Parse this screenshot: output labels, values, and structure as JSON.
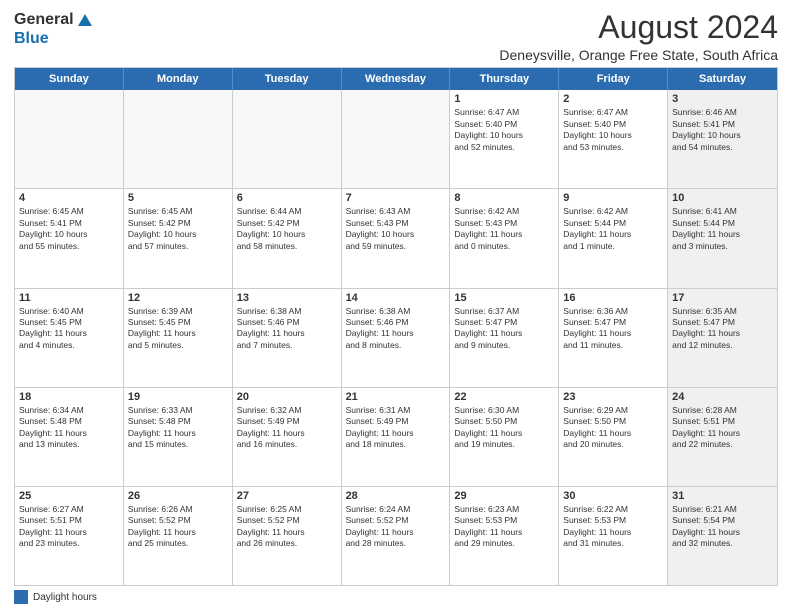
{
  "logo": {
    "general": "General",
    "blue": "Blue"
  },
  "header": {
    "title": "August 2024",
    "subtitle": "Deneysville, Orange Free State, South Africa"
  },
  "days_of_week": [
    "Sunday",
    "Monday",
    "Tuesday",
    "Wednesday",
    "Thursday",
    "Friday",
    "Saturday"
  ],
  "footer": {
    "label": "Daylight hours"
  },
  "weeks": [
    {
      "cells": [
        {
          "day": "",
          "info": "",
          "empty": true
        },
        {
          "day": "",
          "info": "",
          "empty": true
        },
        {
          "day": "",
          "info": "",
          "empty": true
        },
        {
          "day": "",
          "info": "",
          "empty": true
        },
        {
          "day": "1",
          "info": "Sunrise: 6:47 AM\nSunset: 5:40 PM\nDaylight: 10 hours\nand 52 minutes.",
          "empty": false
        },
        {
          "day": "2",
          "info": "Sunrise: 6:47 AM\nSunset: 5:40 PM\nDaylight: 10 hours\nand 53 minutes.",
          "empty": false
        },
        {
          "day": "3",
          "info": "Sunrise: 6:46 AM\nSunset: 5:41 PM\nDaylight: 10 hours\nand 54 minutes.",
          "empty": false,
          "shaded": true
        }
      ]
    },
    {
      "cells": [
        {
          "day": "4",
          "info": "Sunrise: 6:45 AM\nSunset: 5:41 PM\nDaylight: 10 hours\nand 55 minutes.",
          "empty": false
        },
        {
          "day": "5",
          "info": "Sunrise: 6:45 AM\nSunset: 5:42 PM\nDaylight: 10 hours\nand 57 minutes.",
          "empty": false
        },
        {
          "day": "6",
          "info": "Sunrise: 6:44 AM\nSunset: 5:42 PM\nDaylight: 10 hours\nand 58 minutes.",
          "empty": false
        },
        {
          "day": "7",
          "info": "Sunrise: 6:43 AM\nSunset: 5:43 PM\nDaylight: 10 hours\nand 59 minutes.",
          "empty": false
        },
        {
          "day": "8",
          "info": "Sunrise: 6:42 AM\nSunset: 5:43 PM\nDaylight: 11 hours\nand 0 minutes.",
          "empty": false
        },
        {
          "day": "9",
          "info": "Sunrise: 6:42 AM\nSunset: 5:44 PM\nDaylight: 11 hours\nand 1 minute.",
          "empty": false
        },
        {
          "day": "10",
          "info": "Sunrise: 6:41 AM\nSunset: 5:44 PM\nDaylight: 11 hours\nand 3 minutes.",
          "empty": false,
          "shaded": true
        }
      ]
    },
    {
      "cells": [
        {
          "day": "11",
          "info": "Sunrise: 6:40 AM\nSunset: 5:45 PM\nDaylight: 11 hours\nand 4 minutes.",
          "empty": false
        },
        {
          "day": "12",
          "info": "Sunrise: 6:39 AM\nSunset: 5:45 PM\nDaylight: 11 hours\nand 5 minutes.",
          "empty": false
        },
        {
          "day": "13",
          "info": "Sunrise: 6:38 AM\nSunset: 5:46 PM\nDaylight: 11 hours\nand 7 minutes.",
          "empty": false
        },
        {
          "day": "14",
          "info": "Sunrise: 6:38 AM\nSunset: 5:46 PM\nDaylight: 11 hours\nand 8 minutes.",
          "empty": false
        },
        {
          "day": "15",
          "info": "Sunrise: 6:37 AM\nSunset: 5:47 PM\nDaylight: 11 hours\nand 9 minutes.",
          "empty": false
        },
        {
          "day": "16",
          "info": "Sunrise: 6:36 AM\nSunset: 5:47 PM\nDaylight: 11 hours\nand 11 minutes.",
          "empty": false
        },
        {
          "day": "17",
          "info": "Sunrise: 6:35 AM\nSunset: 5:47 PM\nDaylight: 11 hours\nand 12 minutes.",
          "empty": false,
          "shaded": true
        }
      ]
    },
    {
      "cells": [
        {
          "day": "18",
          "info": "Sunrise: 6:34 AM\nSunset: 5:48 PM\nDaylight: 11 hours\nand 13 minutes.",
          "empty": false
        },
        {
          "day": "19",
          "info": "Sunrise: 6:33 AM\nSunset: 5:48 PM\nDaylight: 11 hours\nand 15 minutes.",
          "empty": false
        },
        {
          "day": "20",
          "info": "Sunrise: 6:32 AM\nSunset: 5:49 PM\nDaylight: 11 hours\nand 16 minutes.",
          "empty": false
        },
        {
          "day": "21",
          "info": "Sunrise: 6:31 AM\nSunset: 5:49 PM\nDaylight: 11 hours\nand 18 minutes.",
          "empty": false
        },
        {
          "day": "22",
          "info": "Sunrise: 6:30 AM\nSunset: 5:50 PM\nDaylight: 11 hours\nand 19 minutes.",
          "empty": false
        },
        {
          "day": "23",
          "info": "Sunrise: 6:29 AM\nSunset: 5:50 PM\nDaylight: 11 hours\nand 20 minutes.",
          "empty": false
        },
        {
          "day": "24",
          "info": "Sunrise: 6:28 AM\nSunset: 5:51 PM\nDaylight: 11 hours\nand 22 minutes.",
          "empty": false,
          "shaded": true
        }
      ]
    },
    {
      "cells": [
        {
          "day": "25",
          "info": "Sunrise: 6:27 AM\nSunset: 5:51 PM\nDaylight: 11 hours\nand 23 minutes.",
          "empty": false
        },
        {
          "day": "26",
          "info": "Sunrise: 6:26 AM\nSunset: 5:52 PM\nDaylight: 11 hours\nand 25 minutes.",
          "empty": false
        },
        {
          "day": "27",
          "info": "Sunrise: 6:25 AM\nSunset: 5:52 PM\nDaylight: 11 hours\nand 26 minutes.",
          "empty": false
        },
        {
          "day": "28",
          "info": "Sunrise: 6:24 AM\nSunset: 5:52 PM\nDaylight: 11 hours\nand 28 minutes.",
          "empty": false
        },
        {
          "day": "29",
          "info": "Sunrise: 6:23 AM\nSunset: 5:53 PM\nDaylight: 11 hours\nand 29 minutes.",
          "empty": false
        },
        {
          "day": "30",
          "info": "Sunrise: 6:22 AM\nSunset: 5:53 PM\nDaylight: 11 hours\nand 31 minutes.",
          "empty": false
        },
        {
          "day": "31",
          "info": "Sunrise: 6:21 AM\nSunset: 5:54 PM\nDaylight: 11 hours\nand 32 minutes.",
          "empty": false,
          "shaded": true
        }
      ]
    }
  ]
}
